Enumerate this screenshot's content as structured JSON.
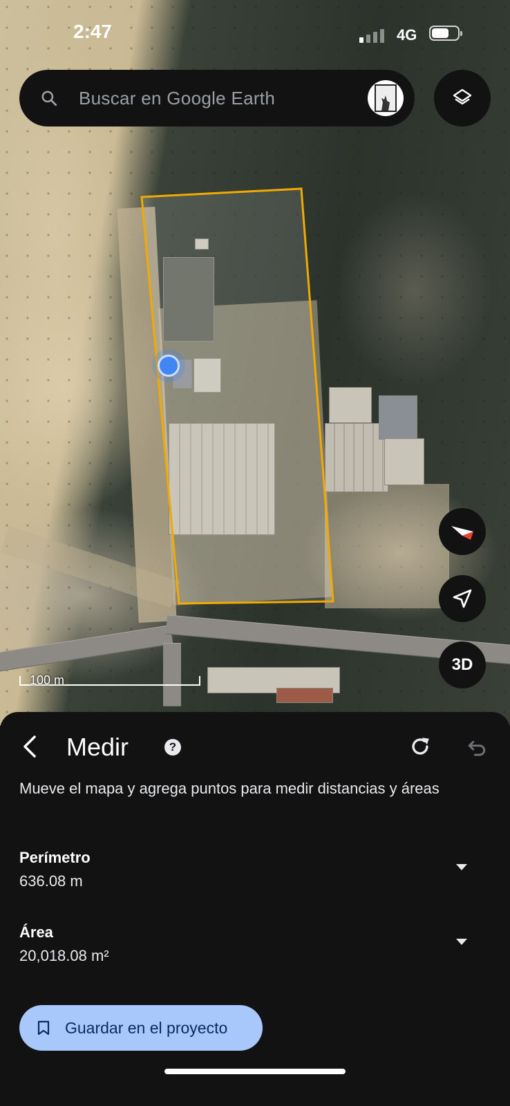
{
  "status_bar": {
    "time": "2:47",
    "network": "4G"
  },
  "search": {
    "placeholder": "Buscar en Google Earth"
  },
  "map": {
    "scale_label": "100 m",
    "measure_color": "#f2a900",
    "location_color": "#4285f4",
    "fab_3d": "3D",
    "icons": [
      "search-icon",
      "layers-icon",
      "compass-icon",
      "navigation-icon"
    ]
  },
  "measure_sheet": {
    "title": "Medir",
    "instructions": "Mueve el mapa y agrega puntos para medir distancias y áreas",
    "perimeter": {
      "label": "Perímetro",
      "value": "636.08 m"
    },
    "area": {
      "label": "Área",
      "value": "20,018.08 m²"
    },
    "save_label": "Guardar en el proyecto",
    "accent": "#a8c7fa"
  }
}
